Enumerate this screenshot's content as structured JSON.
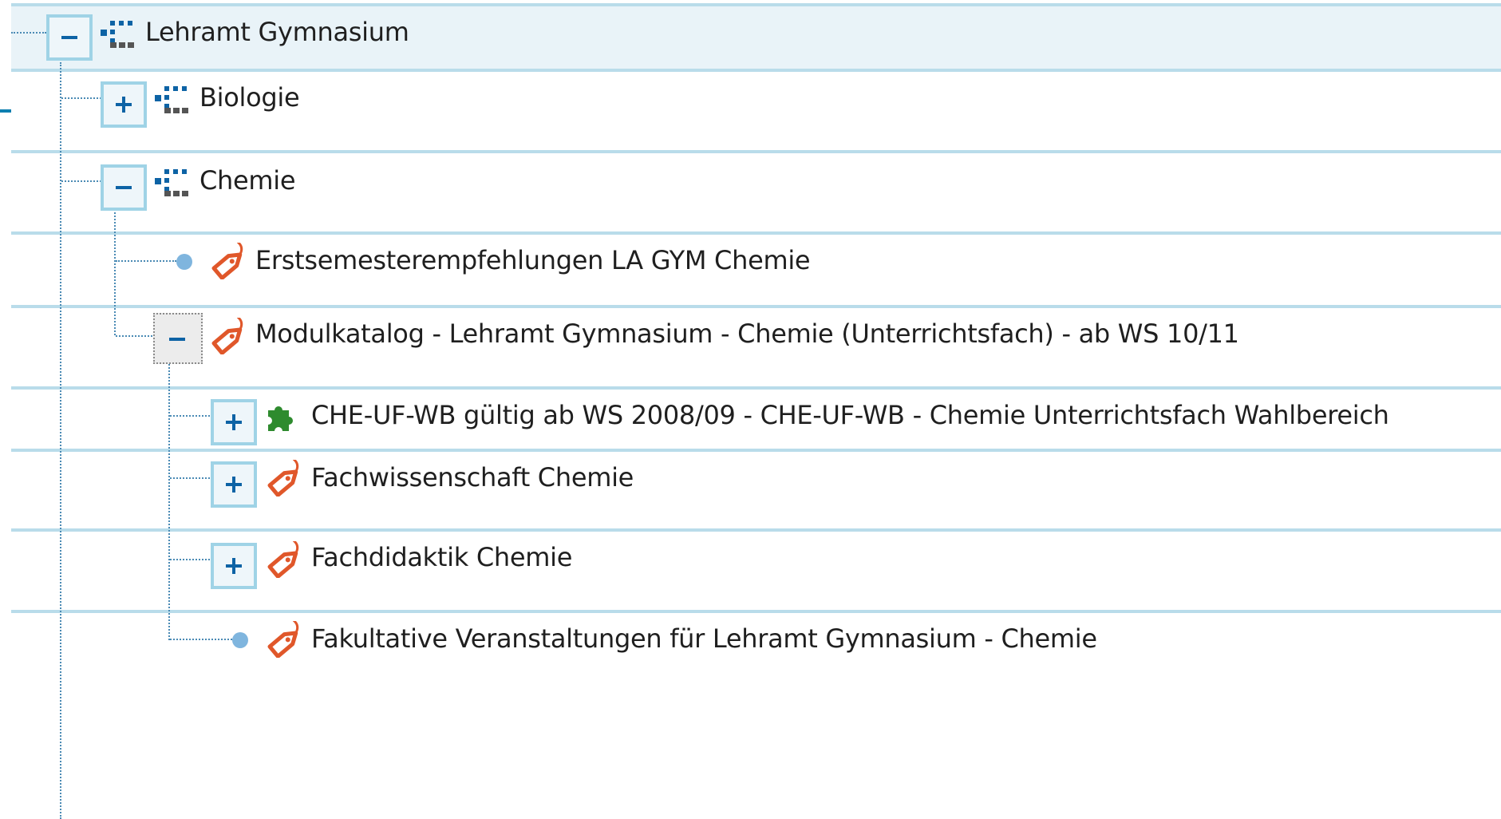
{
  "tree": {
    "nodes": [
      {
        "id": "lehramt-gymnasium",
        "label": "Lehramt Gymnasium",
        "icon": "org-unit-icon",
        "toggle": "collapse"
      },
      {
        "id": "biologie",
        "label": "Biologie",
        "icon": "org-unit-icon",
        "toggle": "expand"
      },
      {
        "id": "chemie",
        "label": "Chemie",
        "icon": "org-unit-icon",
        "toggle": "collapse"
      },
      {
        "id": "erstsemester",
        "label": "Erstsemesterempfehlungen LA GYM Chemie",
        "icon": "tag-icon",
        "toggle": "none"
      },
      {
        "id": "modulkatalog",
        "label": "Modulkatalog - Lehramt Gymnasium - Chemie (Unterrichtsfach) - ab WS 10/11",
        "icon": "tag-icon",
        "toggle": "collapse",
        "focused": true
      },
      {
        "id": "che-uf-wb",
        "label": "CHE-UF-WB gültig ab WS 2008/09 - CHE-UF-WB - Chemie Unterrichtsfach Wahlbereich",
        "icon": "puzzle-piece-icon",
        "toggle": "expand"
      },
      {
        "id": "fachwissenschaft",
        "label": "Fachwissenschaft Chemie",
        "icon": "tag-icon",
        "toggle": "expand"
      },
      {
        "id": "fachdidaktik",
        "label": "Fachdidaktik Chemie",
        "icon": "tag-icon",
        "toggle": "expand"
      },
      {
        "id": "fakultative",
        "label": "Fakultative Veranstaltungen für Lehramt Gymnasium - Chemie",
        "icon": "tag-icon",
        "toggle": "none"
      }
    ]
  },
  "colors": {
    "selected_row": "#e9f3f8",
    "separator": "#b9dcea",
    "toggle_border": "#9fd3e6",
    "toggle_glyph": "#0d63a5",
    "tree_line": "#4a8ab4",
    "tag_icon": "#e0572a",
    "puzzle_icon": "#2e8b2e",
    "org_unit_icon": "#0d63a5"
  }
}
